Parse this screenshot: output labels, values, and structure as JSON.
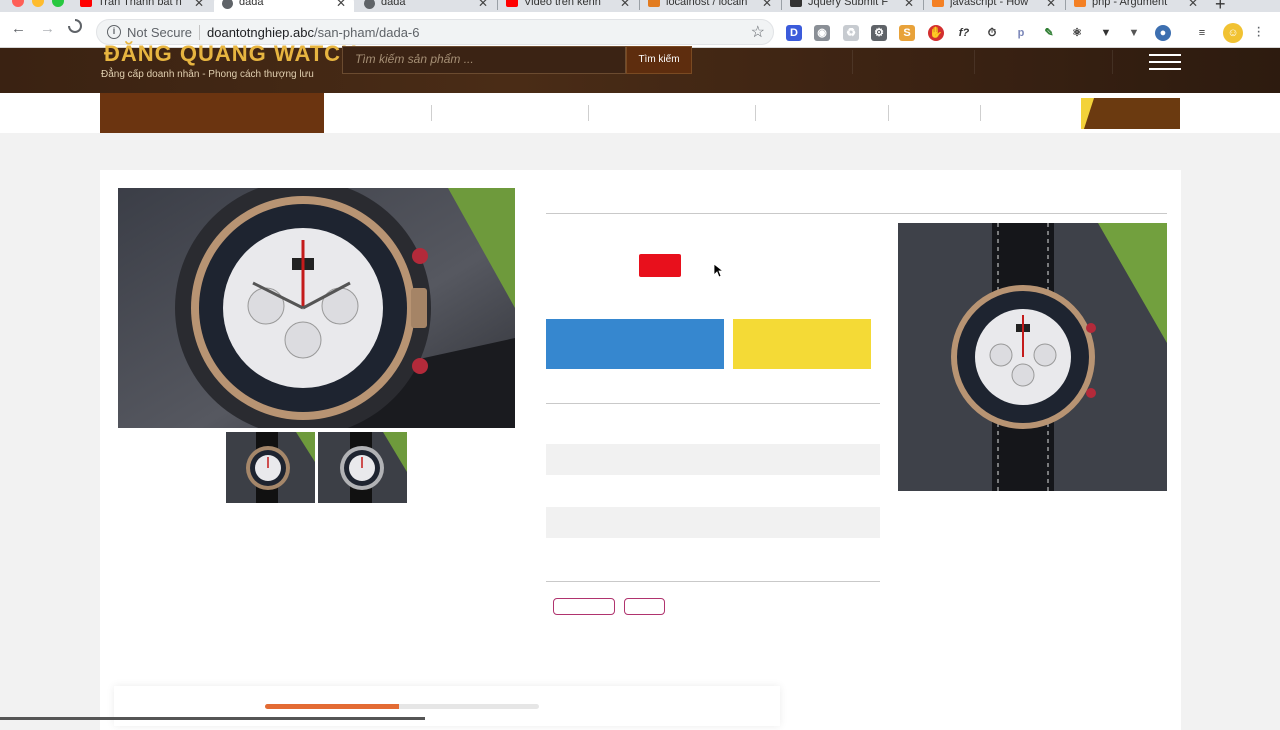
{
  "browser": {
    "tabs": [
      {
        "title": "Tran Thanh bat n",
        "icon": "youtube-icon",
        "color": "#ff0000"
      },
      {
        "title": "dada",
        "icon": "globe-icon",
        "color": "#5f6368",
        "active": true
      },
      {
        "title": "dada",
        "icon": "globe-icon",
        "color": "#5f6368"
      },
      {
        "title": "Video trên kênh",
        "icon": "youtube-icon",
        "color": "#ff0000"
      },
      {
        "title": "localhost / localh",
        "icon": "phpmyadmin-icon",
        "color": "#e27b1f"
      },
      {
        "title": "Jquery Submit F",
        "icon": "tm-icon",
        "color": "#333333"
      },
      {
        "title": "javascript - How",
        "icon": "stackoverflow-icon",
        "color": "#f48024"
      },
      {
        "title": "php - Argument",
        "icon": "stackoverflow-icon",
        "color": "#f48024"
      }
    ],
    "security_label": "Not Secure",
    "url_domain": "doantotnghiep.abc",
    "url_path": "/san-pham/dada-6"
  },
  "site": {
    "logo_text": "ĐĂNG QUANG WATCH",
    "slogan": "Đẳng cấp doanh nhân - Phong cách thượng lưu",
    "search_placeholder": "Tìm kiếm sản phẩm ...",
    "search_button": "Tìm kiếm"
  },
  "product": {
    "selected_color": "#e8101c"
  },
  "loading_progress": 0.49,
  "colors": {
    "header_brown": "#3a2212",
    "nav_home": "#6b3410",
    "buy_blue": "#3687cf",
    "cart_yellow": "#f4da36",
    "logo_gold": "#e7b540"
  }
}
